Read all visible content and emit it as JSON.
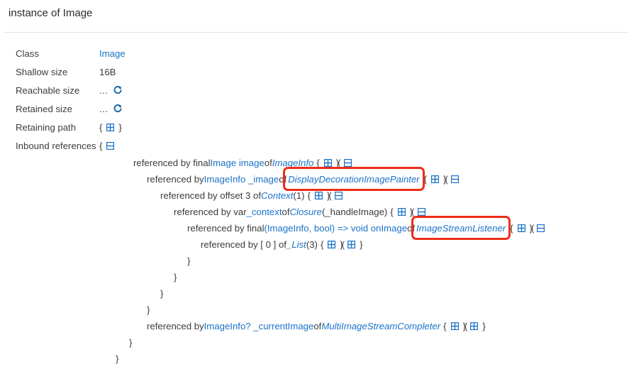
{
  "header": {
    "title": "instance of Image"
  },
  "properties": [
    {
      "label": "Class",
      "value": "Image",
      "value_type": "link"
    },
    {
      "label": "Shallow size",
      "value": "16B",
      "value_type": "text"
    },
    {
      "label": "Reachable size",
      "value": "...",
      "value_type": "refresh",
      "icon": "refresh-icon"
    },
    {
      "label": "Retained size",
      "value": "...",
      "value_type": "refresh",
      "icon": "refresh-icon"
    },
    {
      "label": "Retaining path",
      "value": "",
      "value_type": "collapsed",
      "open_brace": "{",
      "close_brace": "}",
      "icon": "plus-box-icon"
    },
    {
      "label": "Inbound references",
      "value": "",
      "value_type": "expanded",
      "open_brace": "{",
      "icon": "minus-box-icon"
    }
  ],
  "tree": {
    "lines": [
      {
        "indent": 188,
        "parts": [
          {
            "t": "referenced by final ",
            "c": "txt"
          },
          {
            "t": "Image image",
            "c": "id"
          },
          {
            "t": " of ",
            "c": "txt"
          },
          {
            "t": "ImageInfo",
            "c": "cls"
          }
        ],
        "trailer": {
          "open": "{",
          "plus": "plus-box-icon",
          "pair": "}(",
          "minus": "minus-box-icon"
        }
      },
      {
        "indent": 207,
        "parts": [
          {
            "t": "referenced by ",
            "c": "txt"
          },
          {
            "t": "ImageInfo _image",
            "c": "id"
          },
          {
            "t": " of ",
            "c": "txt"
          },
          {
            "t": "DisplayDecorationImagePainter",
            "c": "cls",
            "highlight": true
          }
        ],
        "trailer": {
          "open": "{",
          "plus": "plus-box-icon",
          "pair": "}(",
          "minus": "minus-box-icon"
        }
      },
      {
        "indent": 226,
        "parts": [
          {
            "t": "referenced by offset 3 of ",
            "c": "txt"
          },
          {
            "t": "Context",
            "c": "cls"
          },
          {
            "t": " (1)",
            "c": "cnt"
          }
        ],
        "trailer": {
          "open": "{",
          "plus": "plus-box-icon",
          "pair": "}(",
          "minus": "minus-box-icon"
        }
      },
      {
        "indent": 245,
        "parts": [
          {
            "t": "referenced by var ",
            "c": "txt"
          },
          {
            "t": "_context",
            "c": "id"
          },
          {
            "t": " of ",
            "c": "txt"
          },
          {
            "t": "Closure",
            "c": "cls"
          },
          {
            "t": " (_handleImage)",
            "c": "cnt"
          }
        ],
        "trailer": {
          "open": "{",
          "plus": "plus-box-icon",
          "pair": "}(",
          "minus": "minus-box-icon"
        }
      },
      {
        "indent": 264,
        "parts": [
          {
            "t": "referenced by final ",
            "c": "txt"
          },
          {
            "t": "(ImageInfo, bool) => void onImage",
            "c": "id"
          },
          {
            "t": " of ",
            "c": "txt"
          },
          {
            "t": "ImageStreamListener",
            "c": "cls",
            "highlight": true
          }
        ],
        "trailer": {
          "open": "{",
          "plus": "plus-box-icon",
          "pair": "}(",
          "minus": "minus-box-icon"
        }
      },
      {
        "indent": 283,
        "parts": [
          {
            "t": "referenced by [ 0 ] of ",
            "c": "txt"
          },
          {
            "t": "_List",
            "c": "cls"
          },
          {
            "t": " (3)",
            "c": "cnt"
          }
        ],
        "trailer": {
          "open": "{",
          "plus": "plus-box-icon",
          "pair": "}(",
          "plus2": "plus-box-icon",
          "close": "}"
        }
      },
      {
        "indent": 264,
        "brace": "}"
      },
      {
        "indent": 245,
        "brace": "}"
      },
      {
        "indent": 226,
        "brace": "}"
      },
      {
        "indent": 207,
        "brace": "}"
      },
      {
        "indent": 207,
        "parts": [
          {
            "t": "referenced by ",
            "c": "txt"
          },
          {
            "t": "ImageInfo? _currentImage",
            "c": "id"
          },
          {
            "t": " of ",
            "c": "txt"
          },
          {
            "t": "MultiImageStreamCompleter",
            "c": "cls"
          }
        ],
        "trailer": {
          "open": "{",
          "plus": "plus-box-icon",
          "pair": "}(",
          "plus2": "plus-box-icon",
          "close": "}"
        }
      },
      {
        "indent": 182,
        "brace": "}"
      },
      {
        "indent": 163,
        "brace": "}"
      }
    ]
  },
  "colors": {
    "link": "#1a73c8",
    "highlight": "#ee2d18",
    "text": "#3c3c3c",
    "divider": "#e4e4e4",
    "background": "#ffffff"
  }
}
